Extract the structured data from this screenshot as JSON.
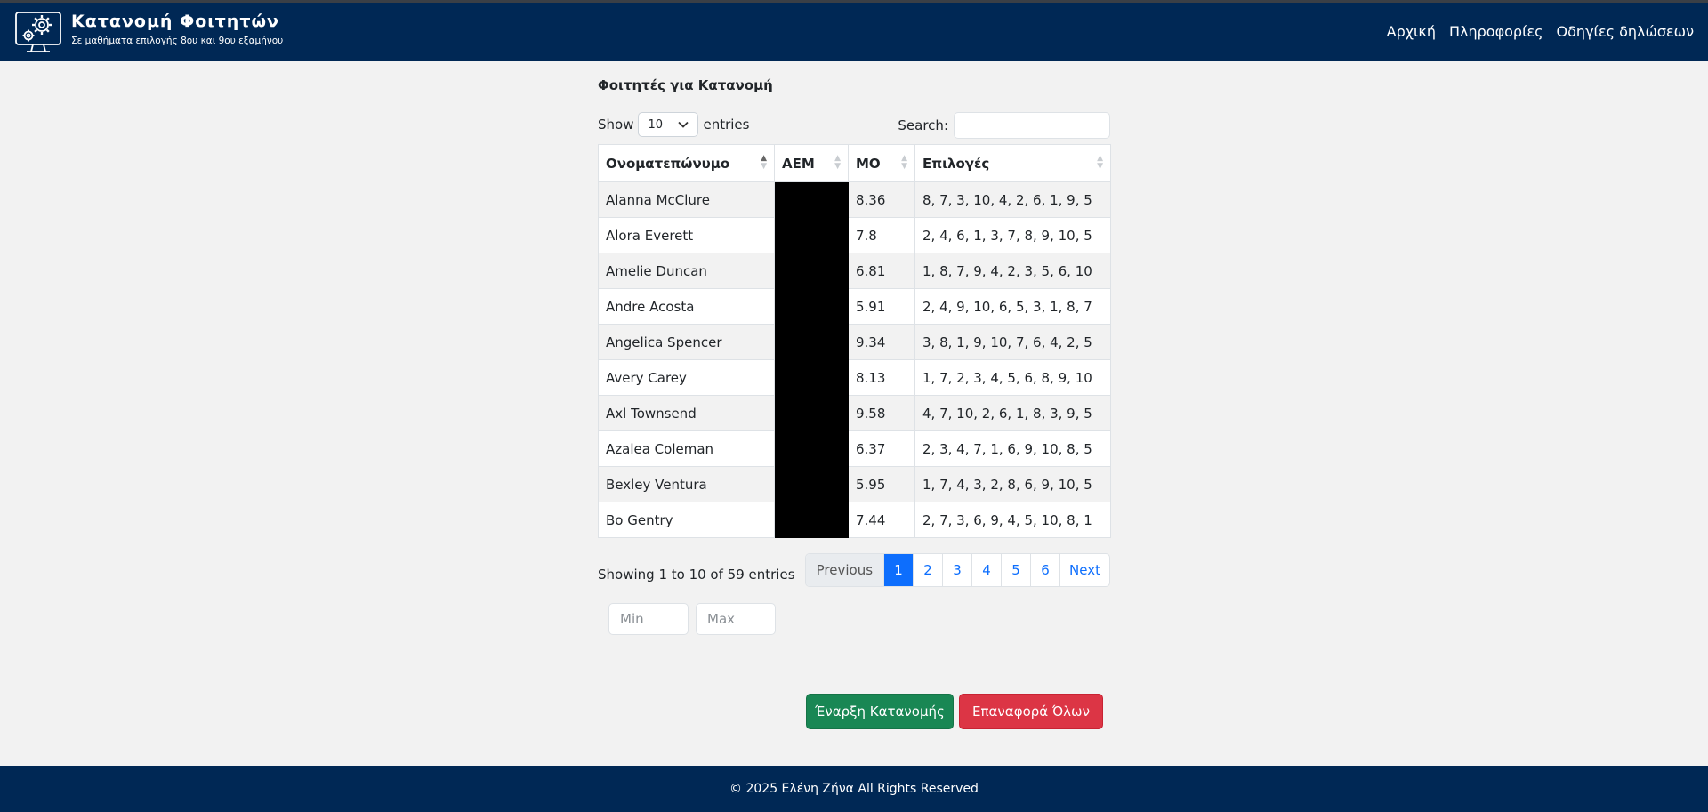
{
  "header": {
    "title": "Κατανομή Φοιτητών",
    "subtitle": "Σε μαθήματα επιλογής 8ου και 9ου εξαμήνου",
    "logo_icon": "gear-monitor-icon",
    "nav": [
      "Αρχική",
      "Πληροφορίες",
      "Οδηγίες δηλώσεων"
    ]
  },
  "main": {
    "section_title": "Φοιτητές για Κατανομή",
    "length": {
      "show_label": "Show",
      "value": "10",
      "entries_label": "entries"
    },
    "search": {
      "label": "Search:",
      "value": ""
    },
    "table": {
      "headers": [
        "Ονοματεπώνυμο",
        "ΑΕΜ",
        "ΜΟ",
        "Επιλογές"
      ],
      "rows": [
        {
          "name": "Alanna McClure",
          "aem": "",
          "mo": "8.36",
          "choices": "8, 7, 3, 10, 4, 2, 6, 1, 9, 5"
        },
        {
          "name": "Alora Everett",
          "aem": "",
          "mo": "7.8",
          "choices": "2, 4, 6, 1, 3, 7, 8, 9, 10, 5"
        },
        {
          "name": "Amelie Duncan",
          "aem": "",
          "mo": "6.81",
          "choices": "1, 8, 7, 9, 4, 2, 3, 5, 6, 10"
        },
        {
          "name": "Andre Acosta",
          "aem": "",
          "mo": "5.91",
          "choices": "2, 4, 9, 10, 6, 5, 3, 1, 8, 7"
        },
        {
          "name": "Angelica Spencer",
          "aem": "",
          "mo": "9.34",
          "choices": "3, 8, 1, 9, 10, 7, 6, 4, 2, 5"
        },
        {
          "name": "Avery Carey",
          "aem": "",
          "mo": "8.13",
          "choices": "1, 7, 2, 3, 4, 5, 6, 8, 9, 10"
        },
        {
          "name": "Axl Townsend",
          "aem": "",
          "mo": "9.58",
          "choices": "4, 7, 10, 2, 6, 1, 8, 3, 9, 5"
        },
        {
          "name": "Azalea Coleman",
          "aem": "",
          "mo": "6.37",
          "choices": "2, 3, 4, 7, 1, 6, 9, 10, 8, 5"
        },
        {
          "name": "Bexley Ventura",
          "aem": "",
          "mo": "5.95",
          "choices": "1, 7, 4, 3, 2, 8, 6, 9, 10, 5"
        },
        {
          "name": "Bo Gentry",
          "aem": "",
          "mo": "7.44",
          "choices": "2, 7, 3, 6, 9, 4, 5, 10, 8, 1"
        }
      ]
    },
    "info": "Showing 1 to 10 of 59 entries",
    "pagination": {
      "previous": "Previous",
      "pages": [
        "1",
        "2",
        "3",
        "4",
        "5",
        "6"
      ],
      "active": "1",
      "next": "Next"
    },
    "filters": {
      "min_placeholder": "Min",
      "max_placeholder": "Max"
    },
    "buttons": {
      "start": "Έναρξη Κατανομής",
      "reset": "Επαναφορά Όλων"
    }
  },
  "footer": {
    "text": "© 2025 Ελένη Ζήνα All Rights Reserved"
  },
  "colors": {
    "navbar": "#002855",
    "primary": "#0d6efd",
    "success": "#198754",
    "danger": "#dc3545"
  }
}
